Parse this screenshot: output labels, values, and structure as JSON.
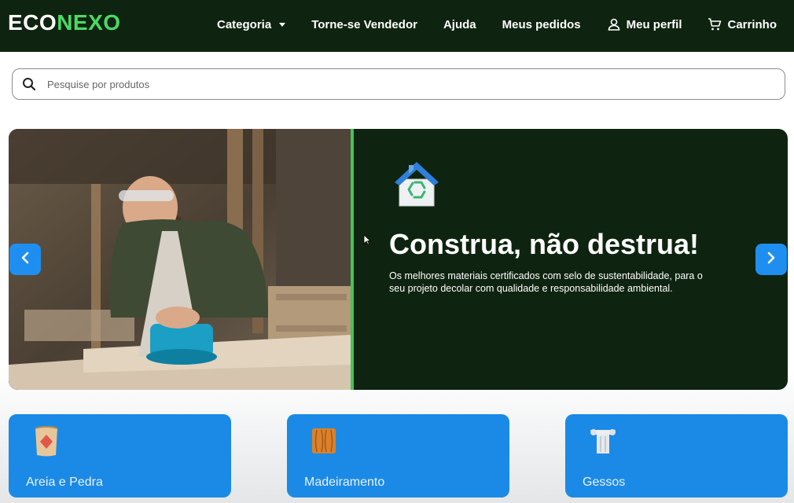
{
  "logo": {
    "part1": "ECO",
    "part2": "NEXO"
  },
  "nav": {
    "categoria": "Categoria",
    "vendedor": "Torne-se Vendedor",
    "ajuda": "Ajuda",
    "pedidos": "Meus pedidos",
    "perfil": "Meu perfil",
    "carrinho": "Carrinho"
  },
  "search": {
    "placeholder": "Pesquise por produtos",
    "value": ""
  },
  "banner": {
    "headline": "Construa, não destrua!",
    "subtitle": "Os melhores materiais certificados com selo de sustentabilidade, para o seu projeto decolar com qualidade e responsabilidade ambiental."
  },
  "categories": [
    {
      "label": "Areia e Pedra",
      "icon": "sand-bag-icon"
    },
    {
      "label": "Madeiramento",
      "icon": "wood-icon"
    },
    {
      "label": "Gessos",
      "icon": "plaster-column-icon"
    }
  ],
  "colors": {
    "header_bg": "#0e2410",
    "brand_green": "#4cd964",
    "accent_blue": "#1b8ae6",
    "divider_green": "#3fc65a"
  }
}
